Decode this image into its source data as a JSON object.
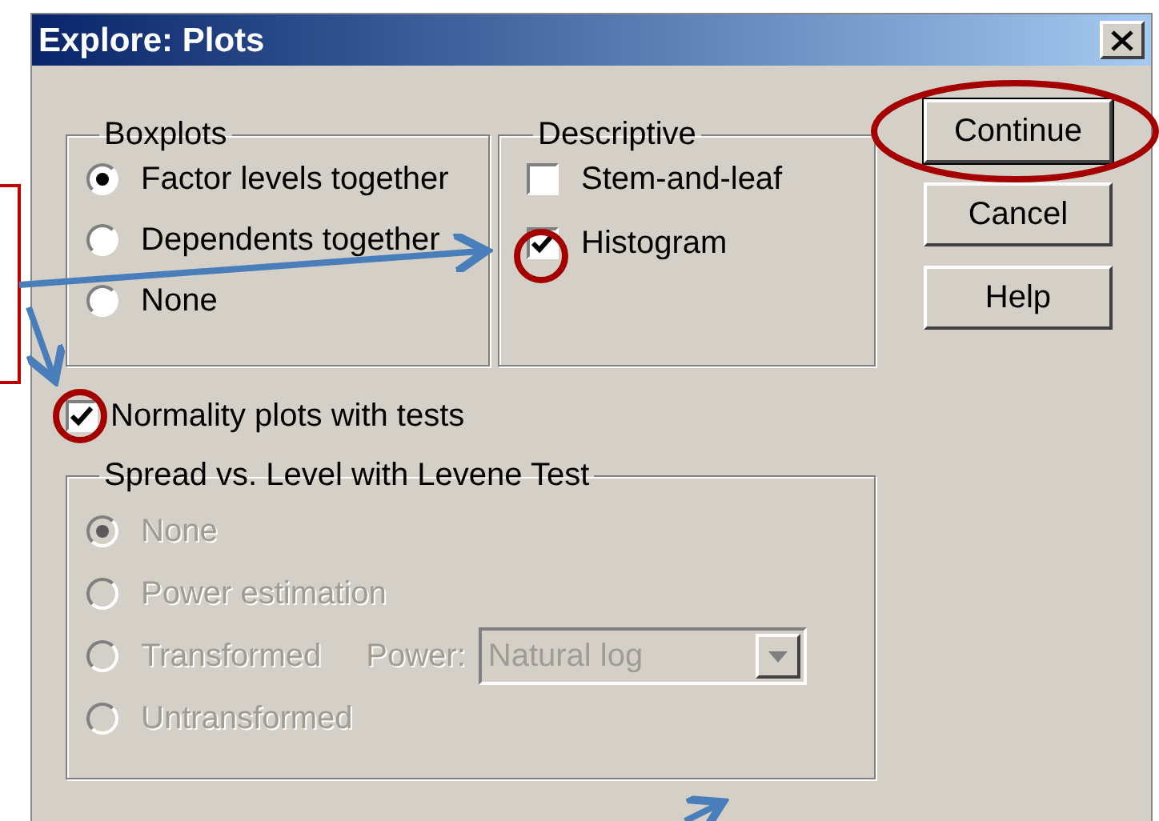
{
  "window": {
    "title": "Explore: Plots"
  },
  "boxplots": {
    "title": "Boxplots",
    "options": [
      {
        "label": "Factor levels together",
        "selected": true
      },
      {
        "label": "Dependents together",
        "selected": false
      },
      {
        "label": "None",
        "selected": false
      }
    ]
  },
  "descriptive": {
    "title": "Descriptive",
    "options": [
      {
        "label": "Stem-and-leaf",
        "checked": false
      },
      {
        "label": "Histogram",
        "checked": true
      }
    ]
  },
  "normality": {
    "label": "Normality plots with tests",
    "checked": true
  },
  "spread": {
    "title": "Spread vs. Level with Levene Test",
    "disabled": true,
    "options": [
      {
        "label": "None",
        "selected": true
      },
      {
        "label": "Power estimation",
        "selected": false
      },
      {
        "label": "Transformed",
        "selected": false
      },
      {
        "label": "Untransformed",
        "selected": false
      }
    ],
    "power": {
      "label": "Power:",
      "value": "Natural log"
    }
  },
  "buttons": [
    {
      "label": "Continue",
      "default": true
    },
    {
      "label": "Cancel",
      "default": false
    },
    {
      "label": "Help",
      "default": false
    }
  ]
}
